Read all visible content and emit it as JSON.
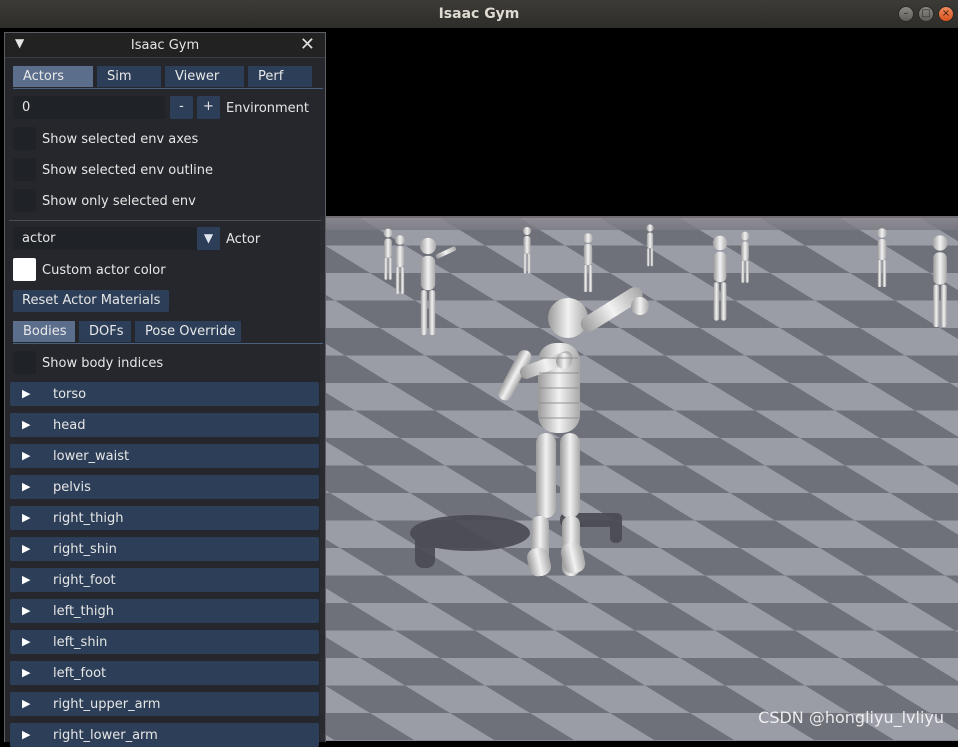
{
  "window": {
    "title": "Isaac Gym"
  },
  "panel": {
    "title": "Isaac Gym",
    "tabs": [
      {
        "label": "Actors",
        "active": true
      },
      {
        "label": "Sim"
      },
      {
        "label": "Viewer"
      },
      {
        "label": "Perf"
      }
    ],
    "environment": {
      "value": "0",
      "minus": "-",
      "plus": "+",
      "label": "Environment"
    },
    "checkboxes": [
      {
        "label": "Show selected env axes",
        "checked": false
      },
      {
        "label": "Show selected env outline",
        "checked": false
      },
      {
        "label": "Show only selected env",
        "checked": false
      }
    ],
    "actor": {
      "value": "actor",
      "label": "Actor"
    },
    "custom_actor_color": {
      "label": "Custom actor color"
    },
    "reset_button": "Reset Actor Materials",
    "subtabs": [
      {
        "label": "Bodies",
        "active": true
      },
      {
        "label": "DOFs"
      },
      {
        "label": "Pose Override"
      }
    ],
    "show_body_indices": "Show body indices",
    "bodies": [
      "torso",
      "head",
      "lower_waist",
      "pelvis",
      "right_thigh",
      "right_shin",
      "right_foot",
      "left_thigh",
      "left_shin",
      "left_foot",
      "right_upper_arm",
      "right_lower_arm"
    ]
  },
  "watermark": "CSDN @hongliyu_lvliyu",
  "colors": {
    "panel_bg": "#26292e",
    "tab": "#2d3f58",
    "tab_active": "#5b6e8c",
    "ground_light": "#9b9ea8",
    "ground_dark": "#6e7079"
  }
}
